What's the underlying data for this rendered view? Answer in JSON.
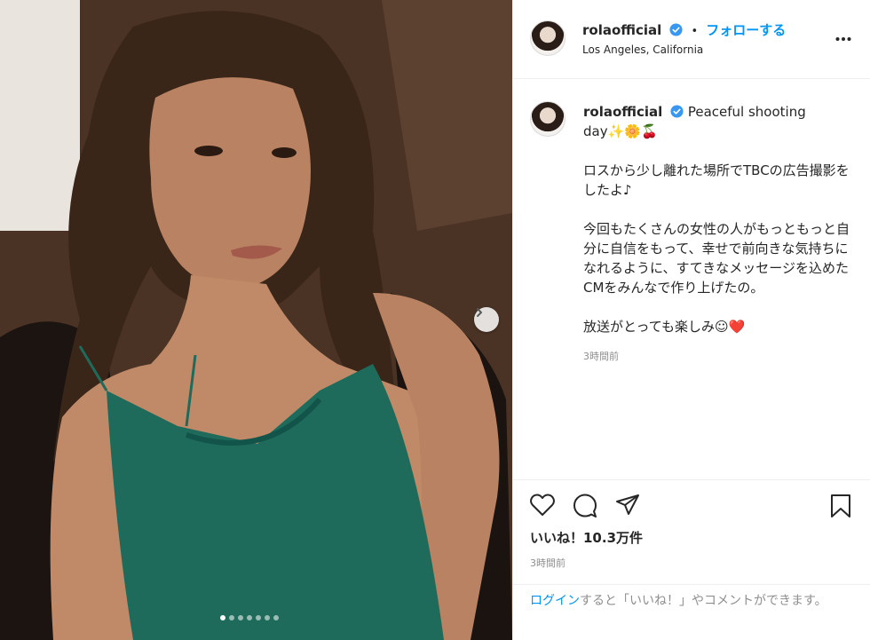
{
  "post": {
    "username": "rolaofficial",
    "follow_label": "フォローする",
    "separator": "•",
    "location": "Los Angeles, California",
    "caption_first": "Peaceful shooting day",
    "caption_emoji": "✨🌼🍒",
    "caption_p1": "ロスから少し離れた場所でTBCの広告撮影をしたよ♪",
    "caption_p2": "今回もたくさんの女性の人がもっともっと自分に自信をもって、幸せで前向きな気持ちになれるように、すてきなメッセージを込めたCMをみんなで作り上げたの。",
    "caption_p3": "放送がとっても楽しみ☺",
    "caption_heart": "❤️",
    "caption_time": "3時間前",
    "likes_text": "いいね！10.3万件",
    "post_time": "3時間前",
    "login_link": "ログイン",
    "login_rest": "すると「いいね！」やコメントができます。"
  },
  "carousel": {
    "total": 7,
    "active_index": 0
  },
  "colors": {
    "link_blue": "#0095f6",
    "verified_blue": "#3897f0",
    "dress_green": "#1e6b5c"
  },
  "icons": [
    "more-icon",
    "heart-icon",
    "comment-icon",
    "share-icon",
    "bookmark-icon",
    "chevron-right-icon",
    "verified-icon"
  ]
}
